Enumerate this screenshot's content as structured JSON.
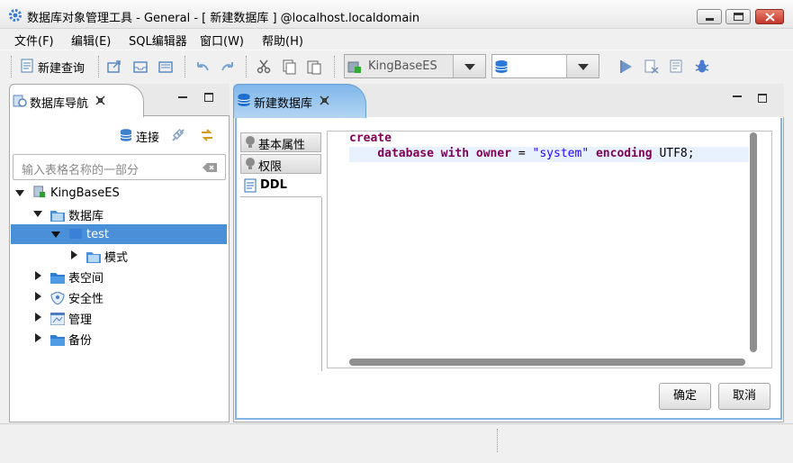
{
  "window": {
    "title": "数据库对象管理工具 - General - [ 新建数据库 ] @localhost.localdomain"
  },
  "menu": [
    "文件(F)",
    "编辑(E)",
    "SQL编辑器",
    "窗口(W)",
    "帮助(H)"
  ],
  "toolbar": {
    "new_query_label": "新建查询",
    "server_combo_value": "KingBaseES",
    "database_combo_value": ""
  },
  "nav": {
    "tab_label": "数据库导航",
    "connect_label": "连接",
    "search_placeholder": "输入表格名称的一部分",
    "tree": {
      "root": "KingBaseES",
      "databases": "数据库",
      "db_test": "test",
      "schemas": "模式",
      "tablespaces": "表空间",
      "security": "安全性",
      "admin": "管理",
      "backup": "备份"
    }
  },
  "editor": {
    "tab_label": "新建数据库",
    "side_tabs": [
      "基本属性",
      "权限",
      "DDL"
    ],
    "active_side_tab": "DDL",
    "code": {
      "line1_kw": "create",
      "line2_kw1": "database",
      "line2_kw2": "with",
      "line2_kw3": "owner",
      "line2_op": "=",
      "line2_str": "\"system\"",
      "line2_kw4": "encoding",
      "line2_val": "UTF8;"
    },
    "ok_label": "确定",
    "cancel_label": "取消"
  }
}
